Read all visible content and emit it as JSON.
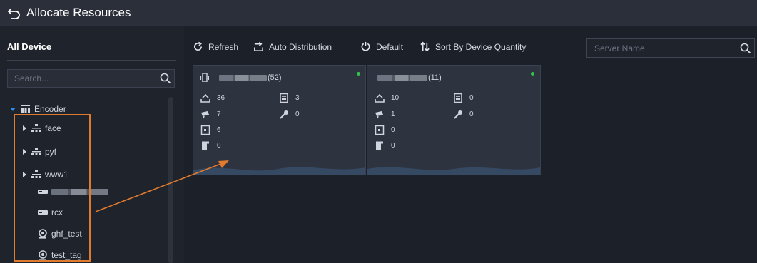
{
  "header": {
    "title": "Allocate Resources"
  },
  "left": {
    "title": "All Device",
    "search_placeholder": "Search...",
    "tree": {
      "root": "Encoder",
      "groups": [
        "face",
        "pyf",
        "www1"
      ],
      "devices": [
        "rcx",
        "ghf_test",
        "test_tag"
      ]
    }
  },
  "toolbar": {
    "refresh": "Refresh",
    "auto_distribution": "Auto Distribution",
    "default": "Default",
    "sort": "Sort By Device Quantity",
    "server_placeholder": "Server Name"
  },
  "servers": [
    {
      "count_label": "(52)",
      "stats": {
        "encoder": "36",
        "storage": "3",
        "camera": "7",
        "tool": "0",
        "door": "6",
        "gate": "0"
      }
    },
    {
      "count_label": "(11)",
      "stats": {
        "encoder": "10",
        "storage": "0",
        "camera": "1",
        "tool": "0",
        "door": "0",
        "gate": "0"
      }
    }
  ],
  "colors": {
    "highlight": "#e07a2e",
    "online": "#31c24a",
    "accent": "#2d8cf0"
  }
}
